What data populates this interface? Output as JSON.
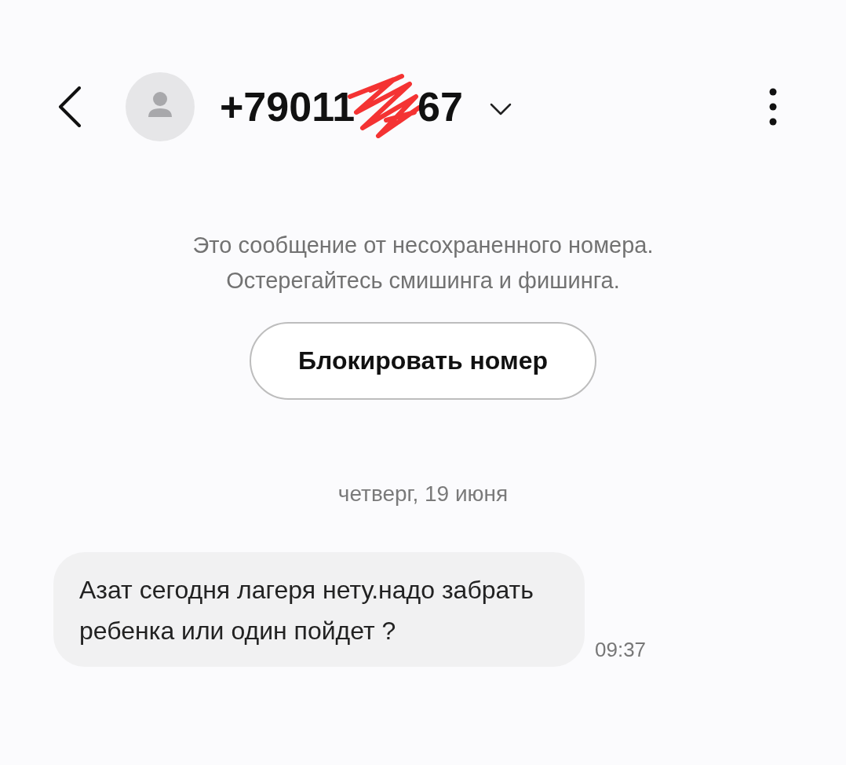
{
  "header": {
    "number_start": "+79011",
    "number_end": "67"
  },
  "notice": {
    "lines": [
      "Это сообщение от несохраненного номера.",
      "Остерегайтесь смишинга и фишинга."
    ],
    "button": "Блокировать номер"
  },
  "date": "четверг, 19 июня",
  "messages": [
    {
      "text": "Азат сегодня лагеря нету.надо забрать ребенка или один пойдет ?",
      "time": "09:37"
    }
  ]
}
